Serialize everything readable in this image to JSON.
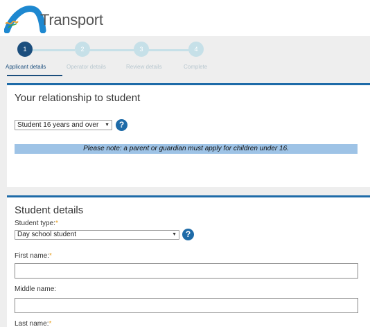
{
  "header": {
    "logo_text": "Transport",
    "colors": {
      "logo_arc_blue": "#1e88d0",
      "logo_arc_orange": "#f0a030",
      "logo_arc_green": "#3aa04a"
    }
  },
  "stepper": {
    "steps": [
      {
        "number": "1",
        "label": "Applicant details",
        "state": "active"
      },
      {
        "number": "2",
        "label": "Operator details",
        "state": "todo"
      },
      {
        "number": "3",
        "label": "Review details",
        "state": "todo"
      },
      {
        "number": "4",
        "label": "Complete",
        "state": "todo"
      }
    ]
  },
  "relationship": {
    "title": "Your relationship to student",
    "select_value": "Student 16 years and over",
    "help_icon": "?",
    "note": "Please note: a parent or guardian must apply for children under 16."
  },
  "student": {
    "title": "Student details",
    "type_label": "Student type:",
    "type_value": "Day school student",
    "help_icon": "?",
    "first_name_label": "First name:",
    "first_name_value": "",
    "middle_name_label": "Middle name:",
    "middle_name_value": "",
    "last_name_label": "Last name:",
    "required_mark": "*"
  },
  "colors": {
    "accent": "#1e6ba8",
    "active_step": "#1b4e7d",
    "inactive_step": "#c6e0e8",
    "note_background": "#9ec3e6",
    "required": "#e8a020"
  }
}
